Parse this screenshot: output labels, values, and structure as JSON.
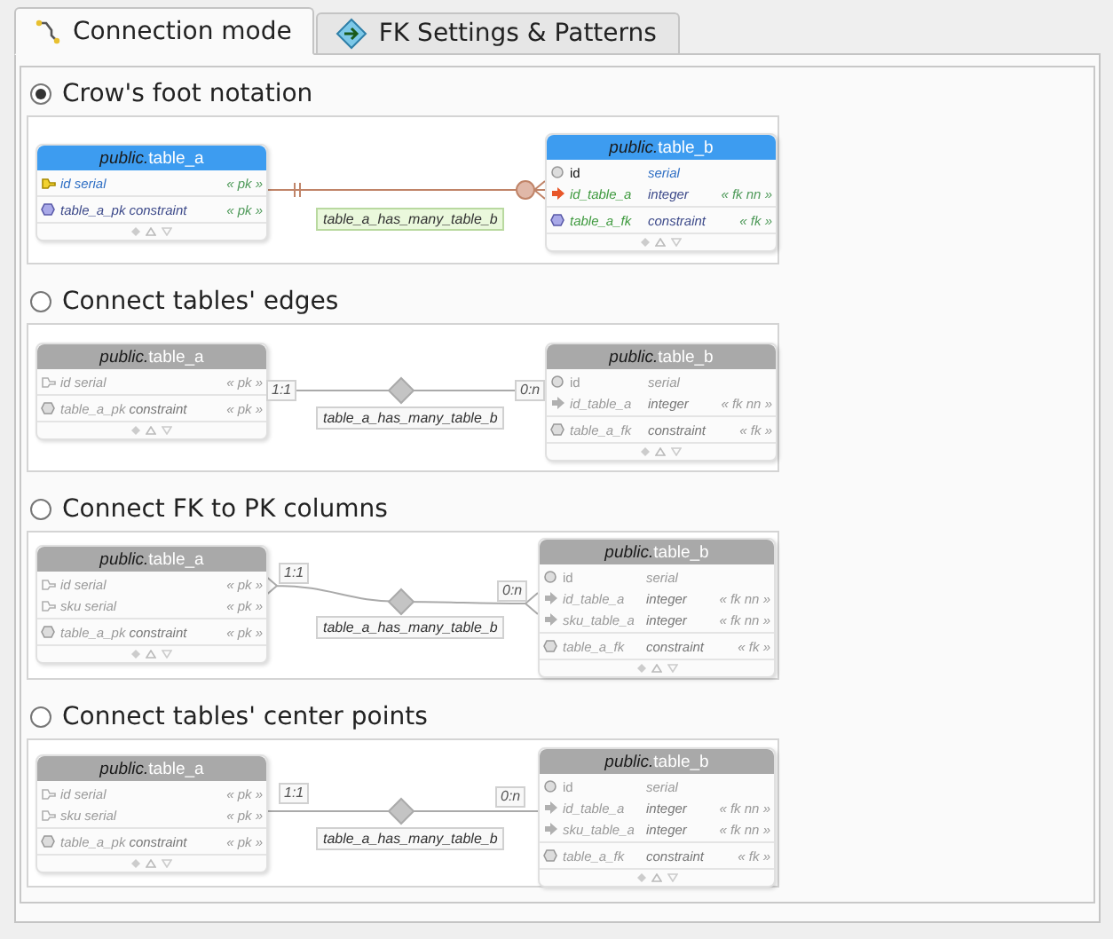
{
  "tabs": [
    {
      "label": "Connection mode",
      "selected": true
    },
    {
      "label": "FK Settings & Patterns",
      "selected": false
    }
  ],
  "modes": [
    {
      "kind": "crowsfoot",
      "label": "Crow's foot notation",
      "selected": true,
      "relationship": "table_a_has_many_table_b",
      "table_a": {
        "schema": "public.",
        "name": "table_a",
        "columns": [
          {
            "kind": "pk",
            "name": "id",
            "type": "serial",
            "tag": "« pk »"
          }
        ],
        "constraints": [
          {
            "kind": "pk_constraint",
            "name": "table_a_pk",
            "type": "constraint",
            "tag": "« pk »"
          }
        ]
      },
      "table_b": {
        "schema": "public.",
        "name": "table_b",
        "columns": [
          {
            "kind": "plain",
            "name": "id",
            "type": "serial"
          },
          {
            "kind": "fk",
            "name": "id_table_a",
            "type": "integer",
            "tag": "« fk nn »"
          }
        ],
        "constraints": [
          {
            "kind": "fk_constraint",
            "name": "table_a_fk",
            "type": "constraint",
            "tag": "« fk »"
          }
        ]
      }
    },
    {
      "kind": "edges",
      "label": "Connect tables' edges",
      "selected": false,
      "relationship": "table_a_has_many_table_b",
      "cardinality_a": "1:1",
      "cardinality_b": "0:n",
      "table_a": {
        "schema": "public.",
        "name": "table_a",
        "columns": [
          {
            "kind": "pk",
            "name": "id",
            "type": "serial",
            "tag": "« pk »"
          }
        ],
        "constraints": [
          {
            "kind": "pk_constraint",
            "name": "table_a_pk",
            "type": "constraint",
            "tag": "« pk »"
          }
        ]
      },
      "table_b": {
        "schema": "public.",
        "name": "table_b",
        "columns": [
          {
            "kind": "plain",
            "name": "id",
            "type": "serial"
          },
          {
            "kind": "fk",
            "name": "id_table_a",
            "type": "integer",
            "tag": "« fk nn »"
          }
        ],
        "constraints": [
          {
            "kind": "fk_constraint",
            "name": "table_a_fk",
            "type": "constraint",
            "tag": "« fk »"
          }
        ]
      }
    },
    {
      "kind": "fk_pk",
      "label": "Connect FK to PK columns",
      "selected": false,
      "relationship": "table_a_has_many_table_b",
      "cardinality_a": "1:1",
      "cardinality_b": "0:n",
      "table_a": {
        "schema": "public.",
        "name": "table_a",
        "columns": [
          {
            "kind": "pk",
            "name": "id",
            "type": "serial",
            "tag": "« pk »"
          },
          {
            "kind": "pk",
            "name": "sku",
            "type": "serial",
            "tag": "« pk »"
          }
        ],
        "constraints": [
          {
            "kind": "pk_constraint",
            "name": "table_a_pk",
            "type": "constraint",
            "tag": "« pk »"
          }
        ]
      },
      "table_b": {
        "schema": "public.",
        "name": "table_b",
        "columns": [
          {
            "kind": "plain",
            "name": "id",
            "type": "serial"
          },
          {
            "kind": "fk",
            "name": "id_table_a",
            "type": "integer",
            "tag": "« fk nn »"
          },
          {
            "kind": "fk",
            "name": "sku_table_a",
            "type": "integer",
            "tag": "« fk nn »"
          }
        ],
        "constraints": [
          {
            "kind": "fk_constraint",
            "name": "table_a_fk",
            "type": "constraint",
            "tag": "« fk »"
          }
        ]
      }
    },
    {
      "kind": "center",
      "label": "Connect tables' center points",
      "selected": false,
      "relationship": "table_a_has_many_table_b",
      "cardinality_a": "1:1",
      "cardinality_b": "0:n",
      "table_a": {
        "schema": "public.",
        "name": "table_a",
        "columns": [
          {
            "kind": "pk",
            "name": "id",
            "type": "serial",
            "tag": "« pk »"
          },
          {
            "kind": "pk",
            "name": "sku",
            "type": "serial",
            "tag": "« pk »"
          }
        ],
        "constraints": [
          {
            "kind": "pk_constraint",
            "name": "table_a_pk",
            "type": "constraint",
            "tag": "« pk »"
          }
        ]
      },
      "table_b": {
        "schema": "public.",
        "name": "table_b",
        "columns": [
          {
            "kind": "plain",
            "name": "id",
            "type": "serial"
          },
          {
            "kind": "fk",
            "name": "id_table_a",
            "type": "integer",
            "tag": "« fk nn »"
          },
          {
            "kind": "fk",
            "name": "sku_table_a",
            "type": "integer",
            "tag": "« fk nn »"
          }
        ],
        "constraints": [
          {
            "kind": "fk_constraint",
            "name": "table_a_fk",
            "type": "constraint",
            "tag": "« fk »"
          }
        ]
      }
    }
  ]
}
